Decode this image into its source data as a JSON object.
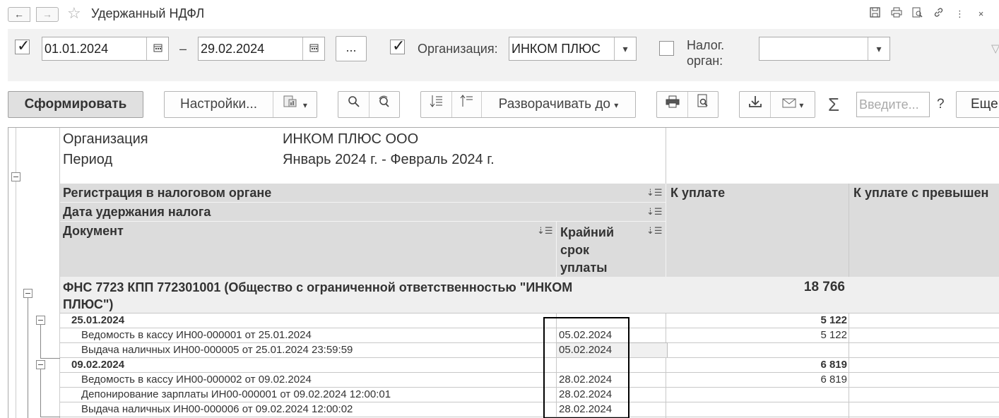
{
  "window": {
    "title": "Удержанный НДФЛ",
    "nav_back": "←",
    "nav_fwd": "→"
  },
  "filters": {
    "date_from": "01.01.2024",
    "dash": "–",
    "date_to": "29.02.2024",
    "dots": "...",
    "org_label": "Организация:",
    "org_value": "ИНКОМ ПЛЮС",
    "taxorg_label_1": "Налог.",
    "taxorg_label_2": "орган:",
    "taxorg_value": ""
  },
  "toolbar": {
    "generate": "Сформировать",
    "settings": "Настройки...",
    "expand_to": "Разворачивать до",
    "search_placeholder": "Введите...",
    "help": "?",
    "more": "Еще"
  },
  "report": {
    "header": {
      "org_label": "Организация",
      "org_value": "ИНКОМ ПЛЮС ООО",
      "period_label": "Период",
      "period_value": "Январь 2024 г. - Февраль 2024 г."
    },
    "columns": {
      "group1": "Регистрация в налоговом органе",
      "group2": "Дата удержания налога",
      "document": "Документ",
      "deadline_1": "Крайний",
      "deadline_2": "срок",
      "deadline_3": "уплаты",
      "to_pay": "К уплате",
      "to_pay_excess": "К уплате с превышен"
    },
    "fns_line_1": "ФНС 7723 КПП 772301001 (Общество с ограниченной ответственностью \"ИНКОМ",
    "fns_line_2": "ПЛЮС\")",
    "fns_total": "18 766",
    "rows": [
      {
        "label": "25.01.2024",
        "deadline": "",
        "amount": "5 122",
        "bold": true
      },
      {
        "label": "Ведомость в кассу ИН00-000001 от 25.01.2024",
        "deadline": "05.02.2024",
        "amount": "5 122",
        "bold": false
      },
      {
        "label": "Выдача наличных ИН00-000005 от 25.01.2024 23:59:59",
        "deadline": "05.02.2024",
        "amount": "",
        "bold": false
      },
      {
        "label": "09.02.2024",
        "deadline": "",
        "amount": "6 819",
        "bold": true
      },
      {
        "label": "Ведомость в кассу ИН00-000002 от 09.02.2024",
        "deadline": "28.02.2024",
        "amount": "6 819",
        "bold": false
      },
      {
        "label": "Депонирование зарплаты ИН00-000001 от 09.02.2024 12:00:01",
        "deadline": "28.02.2024",
        "amount": "",
        "bold": false
      },
      {
        "label": "Выдача наличных ИН00-000006 от 09.02.2024 12:00:02",
        "deadline": "28.02.2024",
        "amount": "",
        "bold": false
      }
    ]
  }
}
